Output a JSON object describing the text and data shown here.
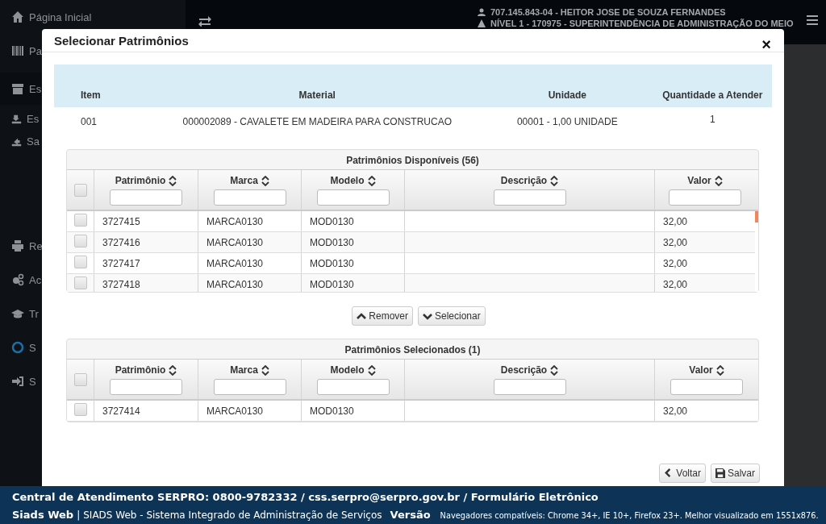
{
  "sidebar": {
    "items": [
      {
        "label": "Página Inicial",
        "sub": false,
        "expanded": false
      },
      {
        "label": "Pa",
        "sub": false,
        "expanded": false
      },
      {
        "label": "Es",
        "sub": false,
        "expanded": true
      },
      {
        "label": "Es",
        "sub": true,
        "expanded": false
      },
      {
        "label": "Sa",
        "sub": true,
        "expanded": false
      },
      {
        "label": "Re",
        "sub": false,
        "expanded": false
      },
      {
        "label": "Ac",
        "sub": false,
        "expanded": false
      },
      {
        "label": "Tr",
        "sub": false,
        "expanded": false
      },
      {
        "label": "S",
        "sub": false,
        "expanded": false
      },
      {
        "label": "S",
        "sub": false,
        "expanded": false
      }
    ]
  },
  "top_bar": {
    "user": "707.145.843-04 - HEITOR JOSE DE SOUZA FERNANDES",
    "unit": "NÍVEL 1 - 170975 - SUPERINTENDÊNCIA DE ADMINISTRAÇÃO DO MEIO"
  },
  "dialog": {
    "title": "Selecionar Patrimônios",
    "close": "×",
    "item_table": {
      "columns": [
        "Item",
        "Material",
        "Unidade",
        "Quantidade a Atender"
      ],
      "rows": [
        [
          "001",
          "000002089 - CAVALETE EM MADEIRA PARA CONSTRUCAO",
          "00001 - 1,00 UNIDADE",
          "1"
        ]
      ]
    },
    "available": {
      "title": "Patrimônios Disponíveis (56)",
      "all_checked": false,
      "columns": [
        "Patrimônio",
        "Marca",
        "Modelo",
        "Descrição",
        "Valor"
      ],
      "rows": [
        {
          "cells": [
            "3727415",
            "MARCA0130",
            "MOD0130",
            "",
            "32,00"
          ],
          "selected": false
        },
        {
          "cells": [
            "3727416",
            "MARCA0130",
            "MOD0130",
            "",
            "32,00"
          ],
          "selected": false
        },
        {
          "cells": [
            "3727417",
            "MARCA0130",
            "MOD0130",
            "",
            "32,00"
          ],
          "selected": false
        },
        {
          "cells": [
            "3727418",
            "MARCA0130",
            "MOD0130",
            "",
            "32,00"
          ],
          "selected": false
        }
      ]
    },
    "move_buttons": [
      "Remover",
      "Selecionar"
    ],
    "selected_table": {
      "title": "Patrimônios Selecionados (1)",
      "all_checked": false,
      "columns": [
        "Patrimônio",
        "Marca",
        "Modelo",
        "Descrição",
        "Valor"
      ],
      "rows": [
        {
          "cells": [
            "3727414",
            "MARCA0130",
            "MOD0130",
            "",
            "32,00"
          ],
          "selected": false
        }
      ]
    },
    "footer_buttons": [
      "Voltar",
      "Salvar"
    ]
  },
  "footer": {
    "contact": "Central de Atendimento SERPRO: 0800-9782332 / css.serpro@serpro.gov.br / Formulário Eletrônico",
    "app": "Siads Web",
    "separator": "|",
    "system": "SIADS Web - Sistema Integrado de Administração de Serviços",
    "version": "Versão",
    "browsers": "Navegadores compatíveis: Chrome 34+, IE 10+, Firefox 23+. Melhor visualizado em 1551x876."
  }
}
